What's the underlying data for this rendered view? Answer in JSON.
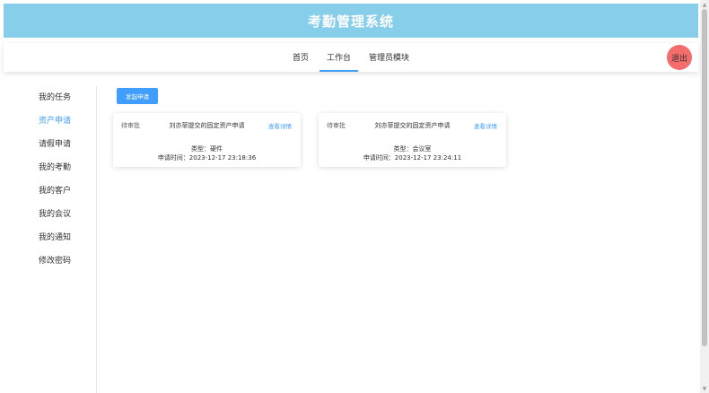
{
  "header": {
    "title": "考勤管理系统"
  },
  "nav": {
    "tabs": [
      {
        "label": "首页"
      },
      {
        "label": "工作台",
        "active": true
      },
      {
        "label": "管理员模块"
      }
    ],
    "logout_label": "退出"
  },
  "sidebar": {
    "items": [
      {
        "label": "我的任务"
      },
      {
        "label": "资产申请",
        "active": true
      },
      {
        "label": "请假申请"
      },
      {
        "label": "我的考勤"
      },
      {
        "label": "我的客户"
      },
      {
        "label": "我的会议"
      },
      {
        "label": "我的通知"
      },
      {
        "label": "修改密码"
      }
    ]
  },
  "main": {
    "apply_button": "发起申请",
    "cards": [
      {
        "status": "待审批",
        "title": "刘亦菲提交的固定资产申请",
        "link": "查看详情",
        "type_line": "类型：硬件",
        "time_line": "申请时间：2023-12-17 23:18:36"
      },
      {
        "status": "待审批",
        "title": "刘亦菲提交的固定资产申请",
        "link": "查看详情",
        "type_line": "类型：会议室",
        "time_line": "申请时间：2023-12-17 23:24:11"
      }
    ]
  },
  "colors": {
    "banner": "#87ceeb",
    "accent": "#409eff",
    "logout": "#f56c6c"
  },
  "icons": {
    "scroll_up": "triangle-up-icon",
    "scroll_down": "triangle-down-icon"
  }
}
